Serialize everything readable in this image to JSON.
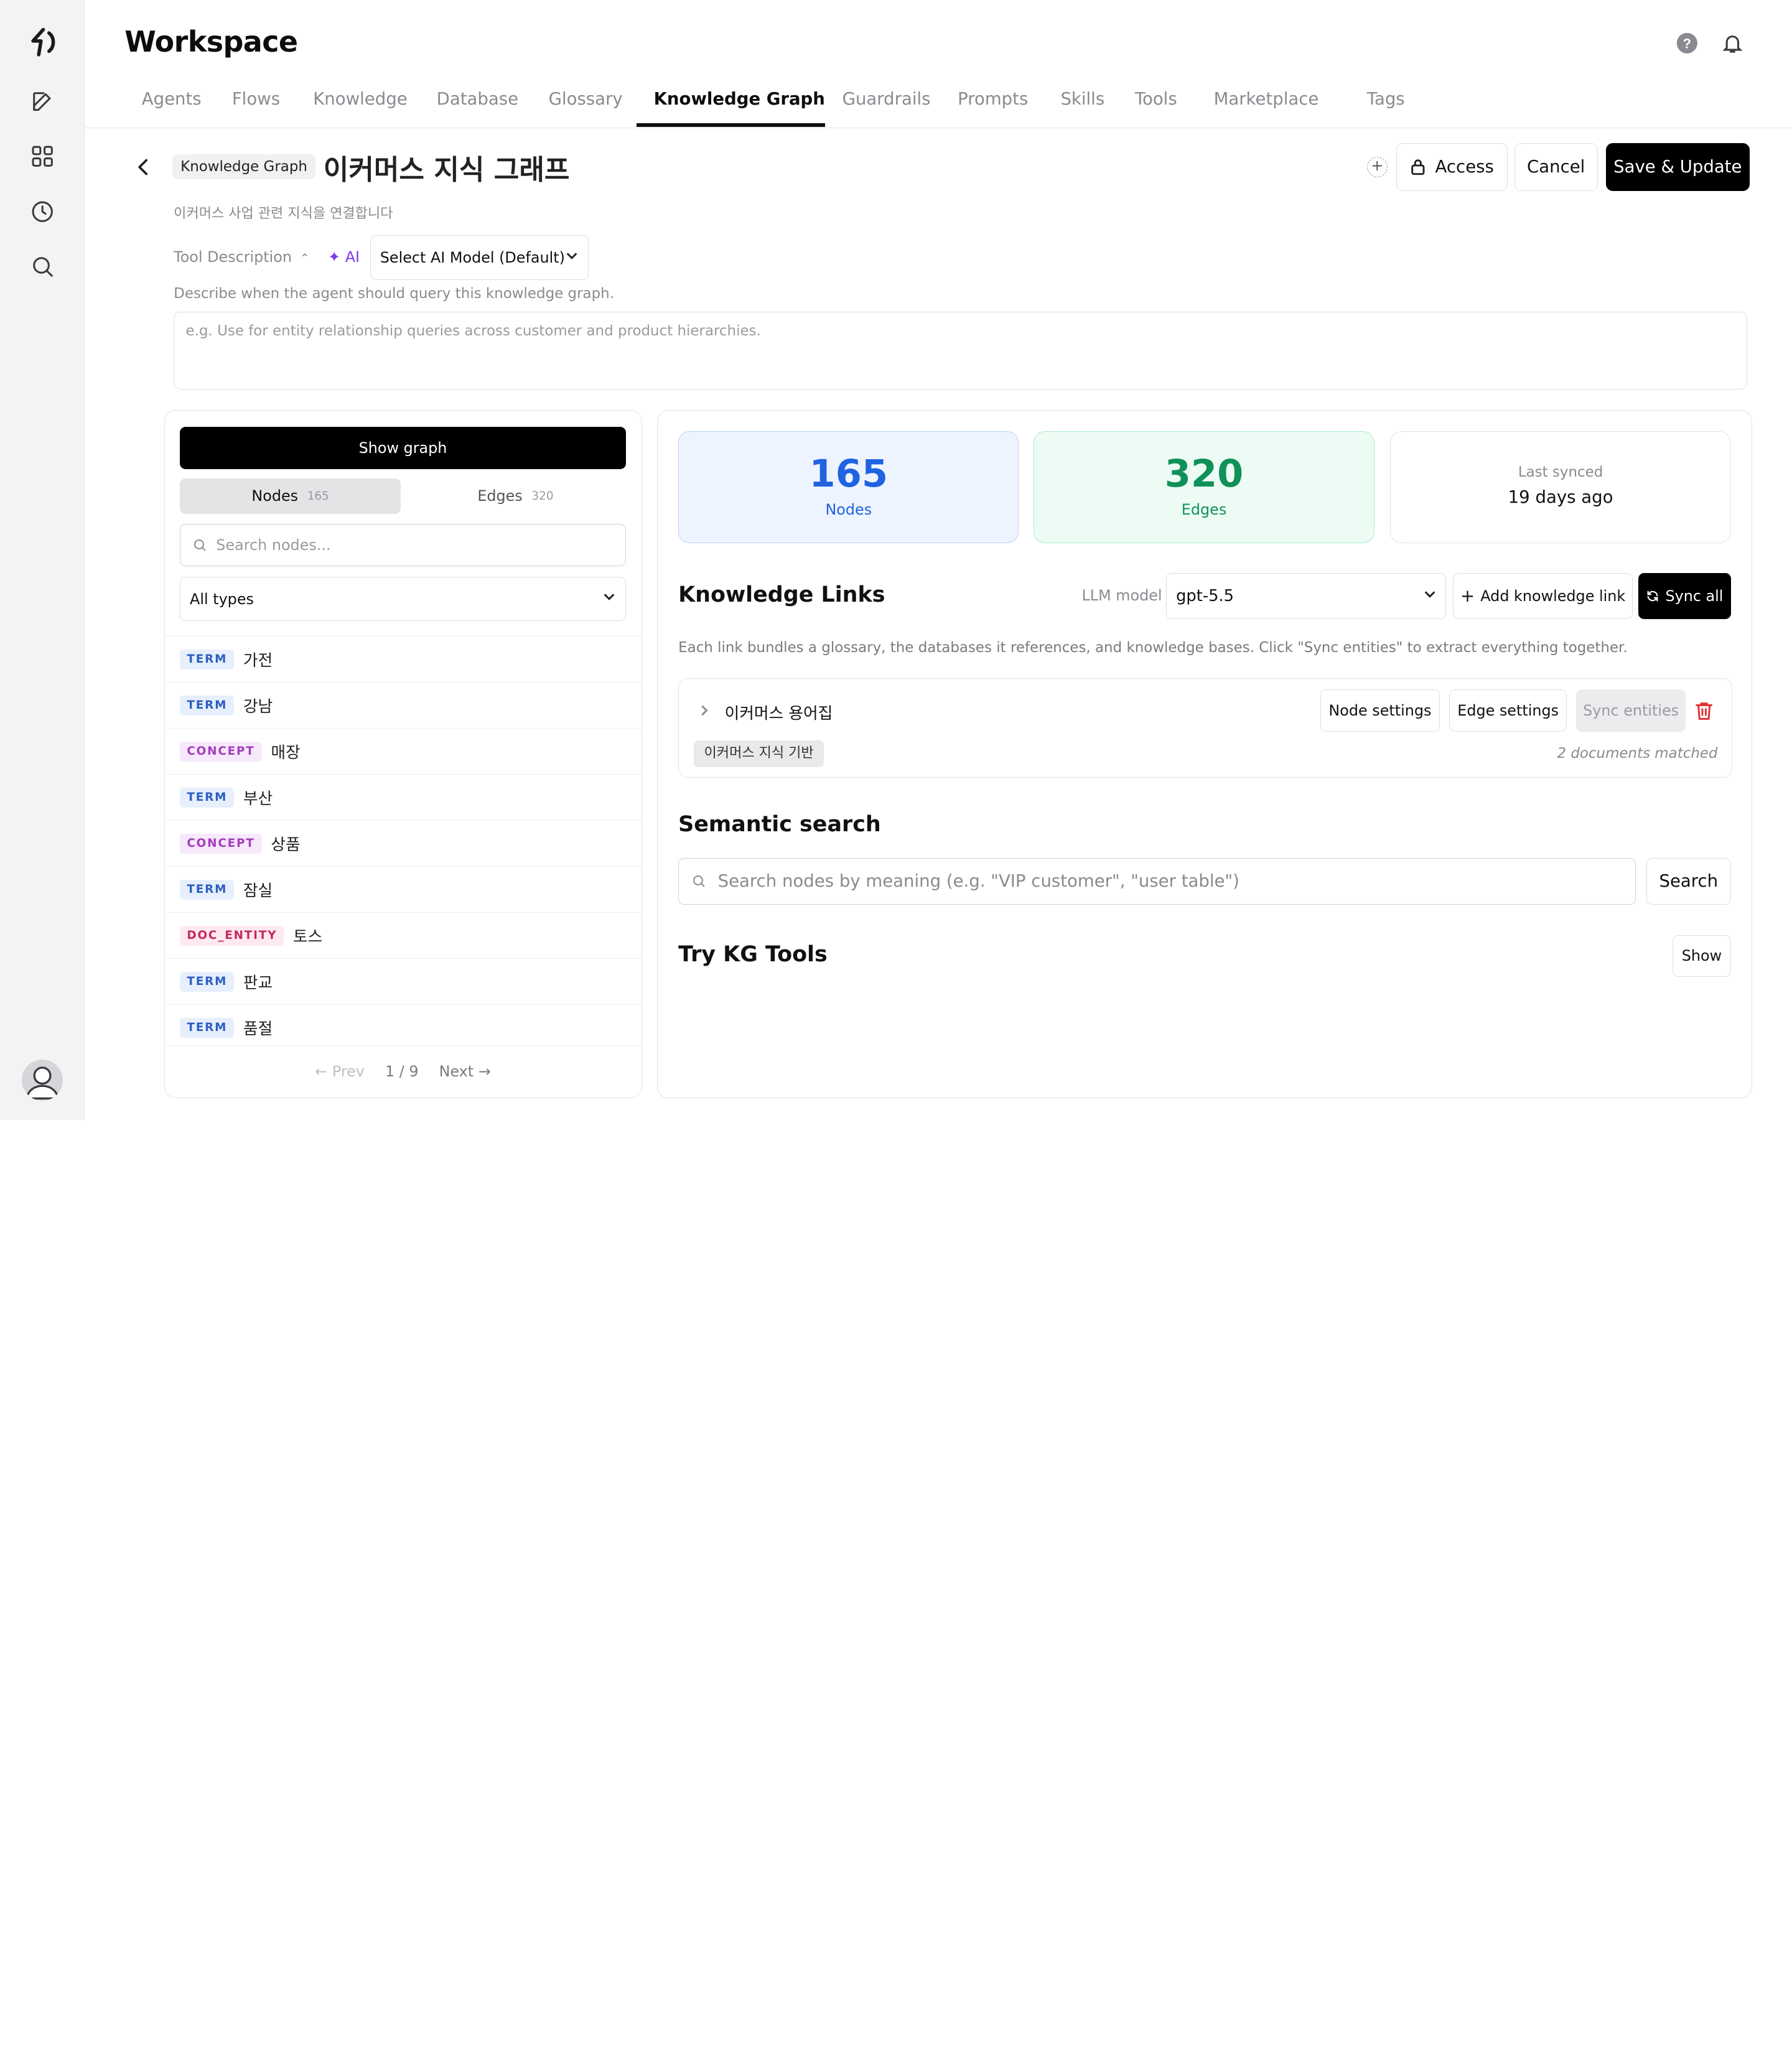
{
  "app": {
    "title": "Workspace"
  },
  "header": {
    "help_icon": "help-circle-icon",
    "bell_icon": "bell-icon"
  },
  "rail": {
    "icons": [
      "logo-icon",
      "edit-icon",
      "apps-grid-icon",
      "clock-icon",
      "search-icon",
      "avatar"
    ]
  },
  "tabs": [
    "Agents",
    "Flows",
    "Knowledge",
    "Database",
    "Glossary",
    "Knowledge Graph",
    "Guardrails",
    "Prompts",
    "Skills",
    "Tools",
    "Marketplace",
    "Tags"
  ],
  "active_tab": "Knowledge Graph",
  "page": {
    "crumb": "Knowledge Graph",
    "name": "이커머스 지식 그래프",
    "subtitle": "이커머스 사업 관련 지식을 연결합니다",
    "access_label": "Access",
    "cancel_label": "Cancel",
    "save_label": "Save & Update",
    "tool_desc_label": "Tool Description",
    "ai_label": "AI",
    "model_select": "Select AI Model (Default)",
    "desc_hint": "Describe when the agent should query this knowledge graph.",
    "desc_placeholder": "e.g. Use for entity relationship queries across customer and product hierarchies."
  },
  "left": {
    "show_graph": "Show graph",
    "nodes_label": "Nodes",
    "nodes_count": "165",
    "edges_label": "Edges",
    "edges_count": "320",
    "search_placeholder": "Search nodes...",
    "type_filter": "All types",
    "nodes": [
      {
        "type": "TERM",
        "label": "가전"
      },
      {
        "type": "TERM",
        "label": "강남"
      },
      {
        "type": "CONCEPT",
        "label": "매장"
      },
      {
        "type": "TERM",
        "label": "부산"
      },
      {
        "type": "CONCEPT",
        "label": "상품"
      },
      {
        "type": "TERM",
        "label": "잠실"
      },
      {
        "type": "DOC_ENTITY",
        "label": "토스"
      },
      {
        "type": "TERM",
        "label": "판교"
      },
      {
        "type": "TERM",
        "label": "품절"
      }
    ],
    "pager": {
      "prev": "← Prev",
      "page": "1 / 9",
      "next": "Next →"
    }
  },
  "right": {
    "stats": {
      "nodes_value": "165",
      "nodes_label": "Nodes",
      "edges_value": "320",
      "edges_label": "Edges",
      "sync_label": "Last synced",
      "sync_value": "19 days ago"
    },
    "links_title": "Knowledge Links",
    "llm_label": "LLM model",
    "llm_value": "gpt-5.5",
    "add_link": "Add knowledge link",
    "sync_all": "Sync all",
    "links_desc": "Each link bundles a glossary, the databases it references, and knowledge bases. Click \"Sync entities\" to extract everything together.",
    "link": {
      "name": "이커머스 용어집",
      "node_settings": "Node settings",
      "edge_settings": "Edge settings",
      "sync_entities": "Sync entities",
      "kb_tag": "이커머스 지식 기반",
      "matched": "2 documents matched"
    },
    "semantic_title": "Semantic search",
    "semantic_placeholder": "Search nodes by meaning (e.g. \"VIP customer\", \"user table\")",
    "search_label": "Search",
    "try_title": "Try KG Tools",
    "show_label": "Show"
  },
  "colors": {
    "nodes_accent": "#1f63e0",
    "edges_accent": "#11915a",
    "term_badge": "#2b5fc0",
    "concept_badge": "#a53cbf",
    "doc_entity_badge": "#c52a5a",
    "delete": "#e03131"
  }
}
